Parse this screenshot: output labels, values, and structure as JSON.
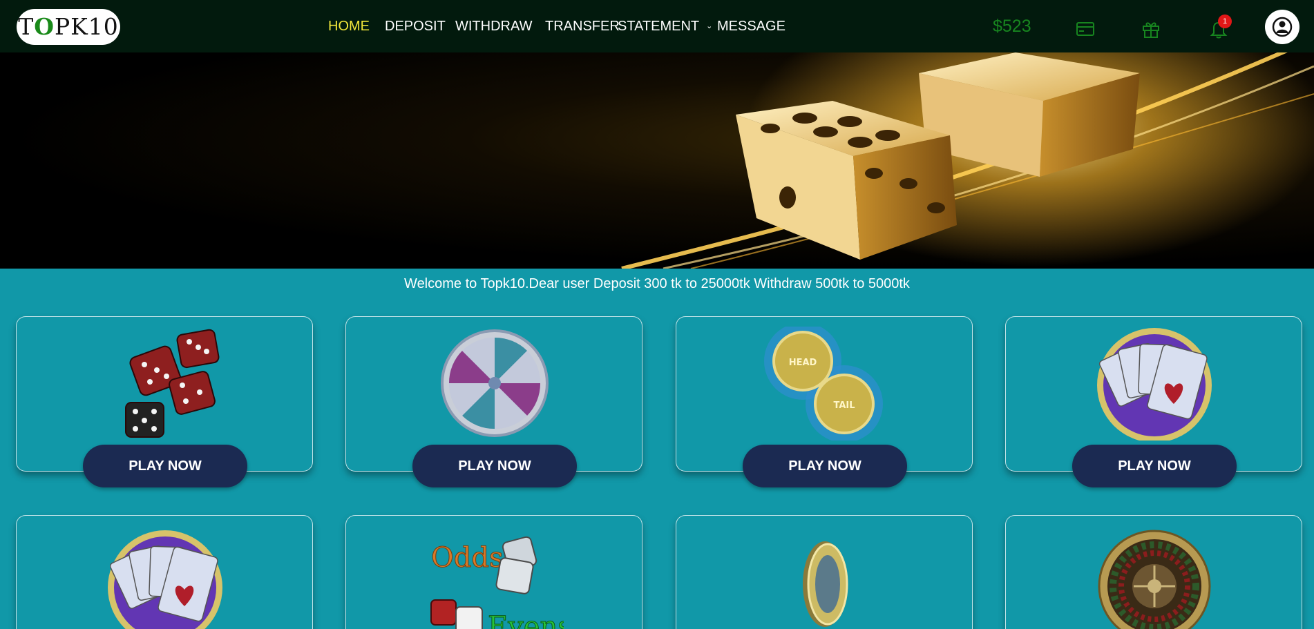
{
  "header": {
    "logo": {
      "prefix": "T",
      "o": "O",
      "suffix": "PK10"
    },
    "nav": [
      {
        "label": "HOME",
        "active": true
      },
      {
        "label": "DEPOSIT"
      },
      {
        "label": "WITHDRAW"
      },
      {
        "label": "TRANSFER"
      },
      {
        "label": "STATEMENT"
      },
      {
        "label": "MESSAGE"
      }
    ],
    "balance": "$523",
    "icons": [
      "wallet-icon",
      "gift-icon",
      "bell-icon",
      "user-icon"
    ],
    "notification_count": "1"
  },
  "welcome": "Welcome to Topk10.Dear user Deposit 300 tk to 25000tk Withdraw 500tk to 5000tk",
  "games": [
    {
      "icon": "dice-icon",
      "button": "PLAY NOW"
    },
    {
      "icon": "wheel-icon",
      "button": "PLAY NOW"
    },
    {
      "icon": "head-tail-coin-icon",
      "button": "PLAY NOW"
    },
    {
      "icon": "playing-cards-icon",
      "button": "PLAY NOW"
    },
    {
      "icon": "playing-cards-icon"
    },
    {
      "icon": "odds-evens-icon",
      "art_text_1": "Odds",
      "art_text_2": "Evens"
    },
    {
      "icon": "coin-icon"
    },
    {
      "icon": "roulette-icon"
    }
  ],
  "coin_labels": {
    "head": "HEAD",
    "tail": "TAIL"
  },
  "colors": {
    "nav_bg": "#021a0d",
    "page_bg": "#1198a8",
    "active_nav": "#f1e63a",
    "balance": "#17851f",
    "button": "#1b2a52"
  }
}
